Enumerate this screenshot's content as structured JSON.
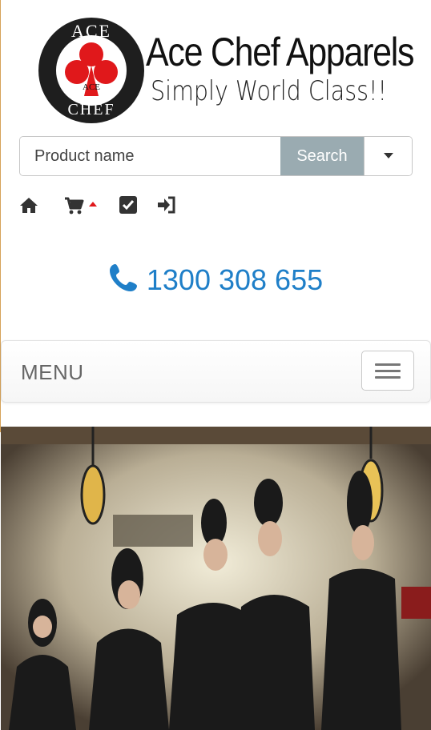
{
  "logo": {
    "badge_top": "ACE",
    "badge_mid": "ACE",
    "badge_bottom": "CHEF",
    "name": "Ace Chef Apparels",
    "tagline": "Simply World Class!!"
  },
  "search": {
    "placeholder": "Product name",
    "button_label": "Search"
  },
  "icons": [
    "home-icon",
    "cart-icon",
    "checkbox-icon",
    "sign-in-icon"
  ],
  "phone": {
    "number": "1300 308 655"
  },
  "menu": {
    "label": "MENU"
  },
  "colors": {
    "accent_blue": "#1f7fc8",
    "search_button": "#9aabb1",
    "logo_red": "#e0181b"
  }
}
